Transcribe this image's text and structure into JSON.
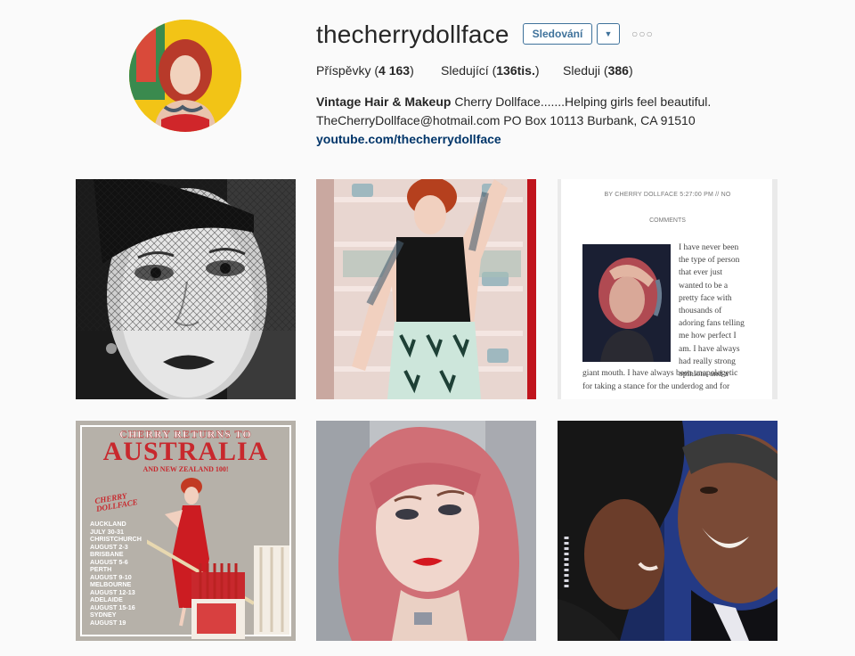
{
  "profile": {
    "username": "thecherrydollface",
    "follow_label": "Sledování",
    "more_label": "○○○",
    "stats": {
      "posts_label": "Příspěvky",
      "posts_count": "4 163",
      "followers_label": "Sledující",
      "followers_count": "136tis.",
      "following_label": "Sleduji",
      "following_count": "386"
    },
    "bio": {
      "name": "Vintage Hair & Makeup",
      "line1": "Cherry Dollface.......Helping girls feel beautiful.",
      "line2": "TheCherryDollface@hotmail.com PO Box 10113 Burbank, CA 91510",
      "link": "youtube.com/thecherrydollface"
    }
  },
  "posts": [
    {
      "name": "bw-veil-portrait"
    },
    {
      "name": "pinup-kitchen-photo"
    },
    {
      "name": "blog-screenshot",
      "meta": "BY CHERRY DOLLFACE  5:27:00 PM //  NO",
      "comments": "COMMENTS",
      "text": [
        "I have never been",
        "the type of person",
        "that ever just",
        "wanted to be a",
        "pretty face with",
        "thousands of",
        "adoring fans telling",
        "me how perfect I",
        "am. I have always",
        "had really strong",
        "opinions and a",
        "giant mouth. I have always been unapologetic",
        "for taking a stance for the underdog and for"
      ]
    },
    {
      "name": "australia-tour-poster",
      "title1": "CHERRY RETURNS TO",
      "title2": "AUSTRALIA",
      "title3": "AND NEW ZEALAND 100!",
      "logo": "CHERRY DOLLFACE",
      "schedule": [
        "AUCKLAND",
        "JULY 30-31",
        "CHRISTCHURCH",
        "AUGUST 2-3",
        "BRISBANE",
        "AUGUST 5-6",
        "PERTH",
        "AUGUST 9-10",
        "MELBOURNE",
        "AUGUST 12-13",
        "ADELAIDE",
        "AUGUST 15-16",
        "SYDNEY",
        "AUGUST 19"
      ]
    },
    {
      "name": "pink-hair-selfie"
    },
    {
      "name": "couple-photo"
    }
  ]
}
